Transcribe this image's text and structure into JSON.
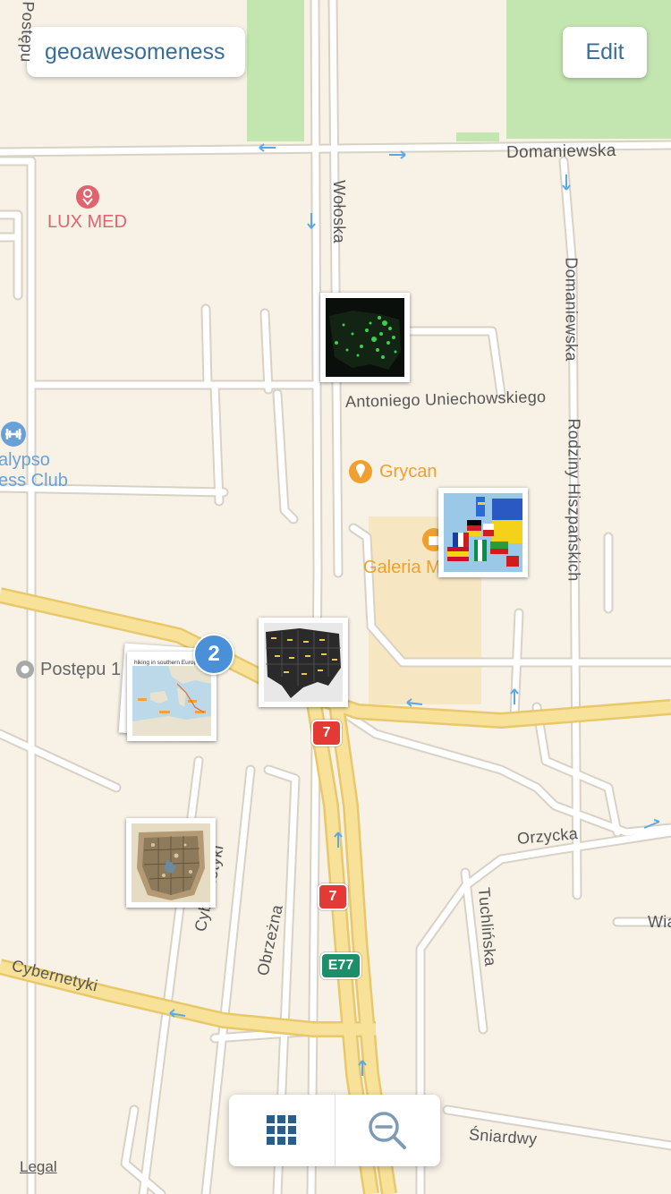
{
  "header": {
    "back_label": "geoawesomeness",
    "edit_label": "Edit"
  },
  "pois": {
    "luxmed": "LUX MED",
    "grycan": "Grycan",
    "galeria": "Galeria M",
    "gym_line1": "alypso",
    "gym_line2": "ess Club",
    "postepu": "Postępu 1"
  },
  "roads": {
    "domaniewska_h": "Domaniewska",
    "wołoska": "Wołoska",
    "domaniewska_v": "Domaniewska",
    "uniechowskiego": "Antoniego Uniechowskiego",
    "rodziny": "Rodziny Hiszpańskich",
    "postepu_top": "Postępu",
    "orzycka": "Orzycka",
    "tuchlinska": "Tuchlińska",
    "cybernetyki": "Cybernetyki",
    "cybernetyki_v": "Cybernetyki",
    "obrzezna": "Obrzeżna",
    "sniardwy": "Śniardwy",
    "wia": "Wia"
  },
  "shields": {
    "route_7_top": "7",
    "route_7_bottom": "7",
    "e77": "E77"
  },
  "cluster_count": "2",
  "thumbnail_titles": {
    "us_lights": "US night lights map",
    "europe_flags": "Europe flags map",
    "us_states": "US states map",
    "southern_europe": "hiking in southern Europe",
    "old_map": "antique map"
  },
  "toolbar": {
    "grid_icon": "grid-icon",
    "zoom_out_icon": "zoom-out-icon"
  },
  "legal": "Legal",
  "colors": {
    "accent": "#3a6e96",
    "badge": "#4a90d9",
    "park": "#c3e5b0",
    "highway": "#f5d780",
    "route_red": "#e53935",
    "route_green": "#1a8f6a",
    "poi_red": "#e0646e",
    "poi_orange": "#f0a030",
    "poi_blue": "#6aa0d8"
  }
}
